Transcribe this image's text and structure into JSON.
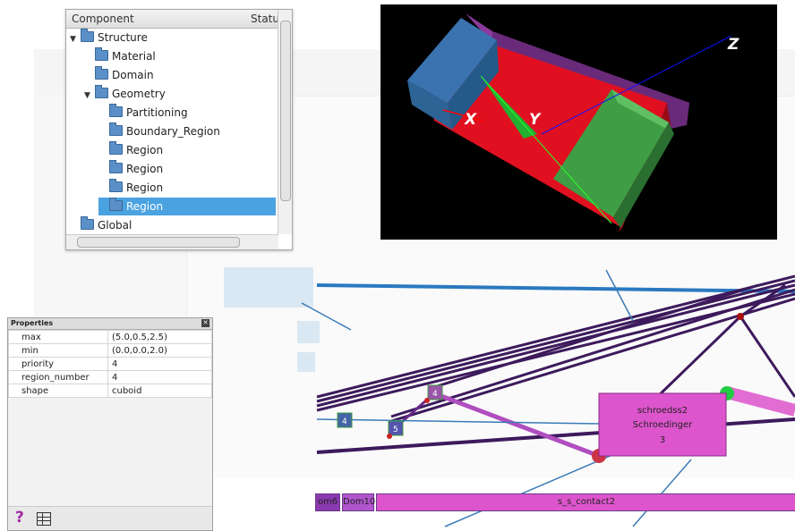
{
  "tree": {
    "header_component": "Component",
    "header_status": "Statu",
    "items": [
      {
        "label": "Structure",
        "level": 0,
        "expanded": true
      },
      {
        "label": "Material",
        "level": 1
      },
      {
        "label": "Domain",
        "level": 1
      },
      {
        "label": "Geometry",
        "level": 1,
        "expanded": true
      },
      {
        "label": "Partitioning",
        "level": 2
      },
      {
        "label": "Boundary_Region",
        "level": 2
      },
      {
        "label": "Region",
        "level": 2
      },
      {
        "label": "Region",
        "level": 2
      },
      {
        "label": "Region",
        "level": 2
      },
      {
        "label": "Region",
        "level": 2,
        "selected": true
      },
      {
        "label": "Global",
        "level": 0
      }
    ]
  },
  "view3d": {
    "axis_x": "X",
    "axis_y": "Y",
    "axis_z": "Z"
  },
  "properties": {
    "title": "Properties",
    "rows": [
      {
        "key": "max",
        "value": "(5.0,0.5,2.5)"
      },
      {
        "key": "min",
        "value": "(0.0,0.0,2.0)"
      },
      {
        "key": "priority",
        "value": "4"
      },
      {
        "key": "region_number",
        "value": "4"
      },
      {
        "key": "shape",
        "value": "cuboid"
      }
    ],
    "help_icon": "question-icon",
    "table_icon": "table-icon"
  },
  "graph": {
    "nodes": [
      {
        "label": "4"
      },
      {
        "label": "5"
      },
      {
        "label": "4"
      }
    ],
    "main_node": {
      "line1": "schroedss2",
      "line2": "Schroedinger",
      "line3": "3"
    },
    "tabs": [
      "om6",
      "Dom10",
      "s_s_contact2"
    ]
  },
  "colors": {
    "selection": "#4aa2e0",
    "node_fill": "#dd55cc",
    "edge": "#3d1a5c",
    "accent_blue": "#3a7ab8"
  }
}
